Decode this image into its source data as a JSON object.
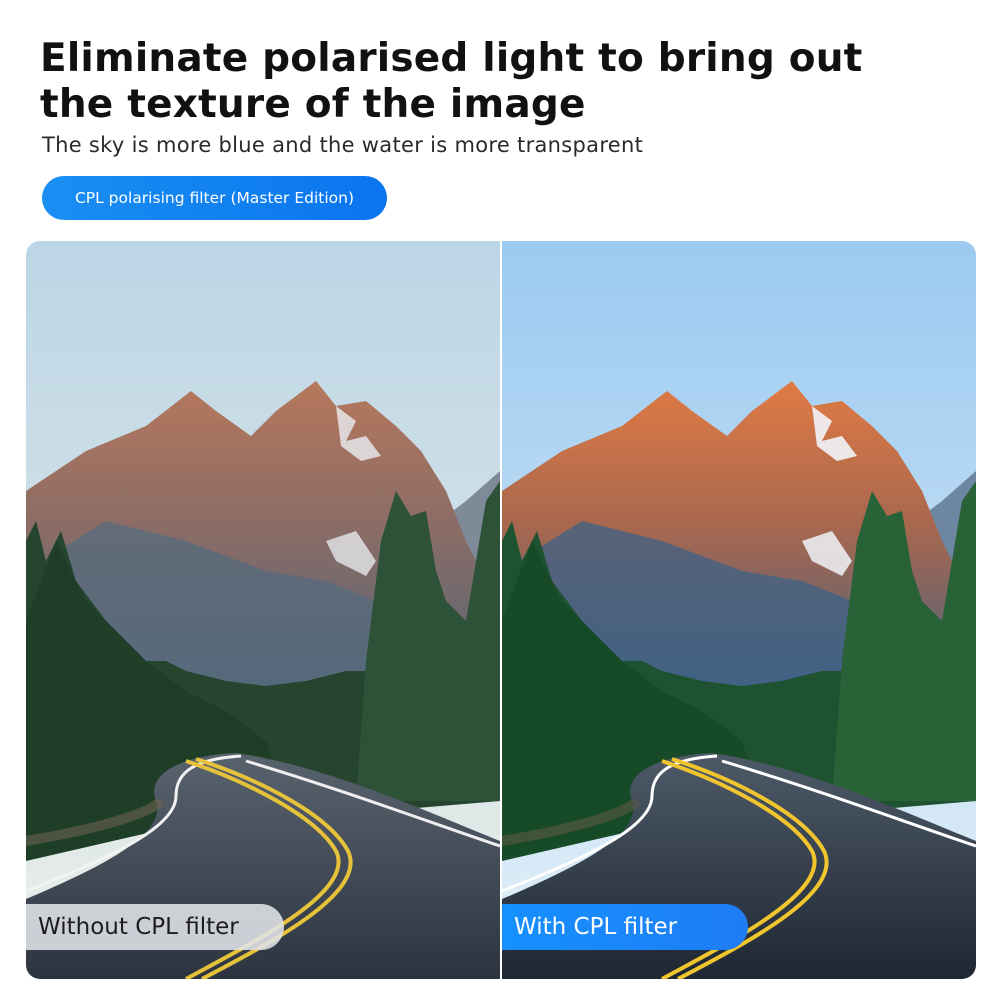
{
  "header": {
    "title": "Eliminate polarised light to bring out the texture of the image",
    "subtitle": "The sky is more blue and the water is more transparent",
    "product_badge": "CPL polarising filter (Master Edition)"
  },
  "comparison": {
    "left_label": "Without CPL filter",
    "right_label": "With CPL filter"
  },
  "colors": {
    "accent_blue": "#1a8ff2",
    "title_text": "#111111"
  }
}
